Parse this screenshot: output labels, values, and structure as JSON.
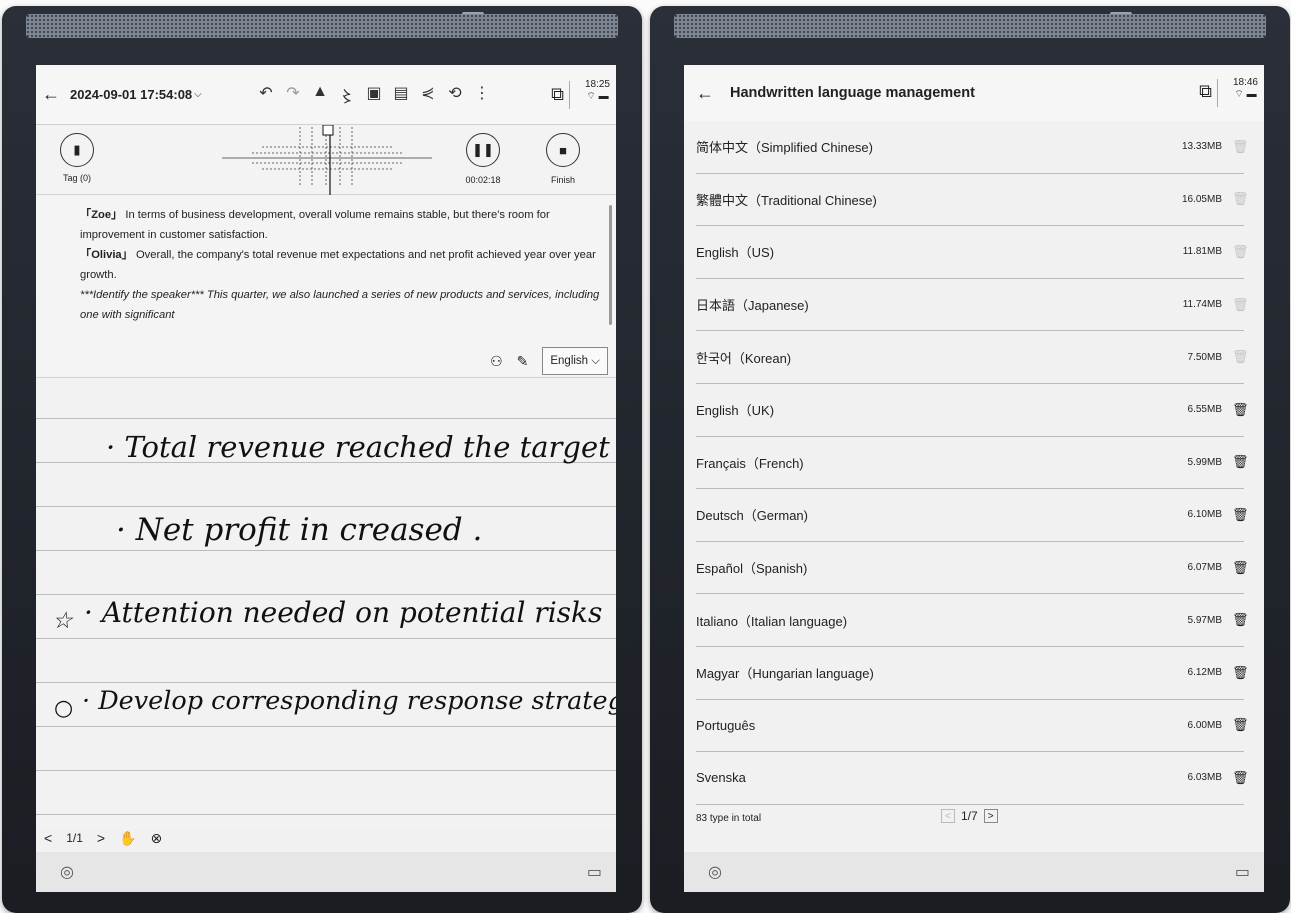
{
  "left": {
    "header": {
      "title": "2024-09-01 17:54:08",
      "caret": "⌵",
      "back_icon": "arrow-left-icon",
      "time": "18:25",
      "tools": [
        "⮌",
        "⮎",
        "▲",
        "〽",
        "◫",
        "▣",
        "⋘",
        "⟲",
        "⋮"
      ]
    },
    "recorder": {
      "tag_label": "Tag (0)",
      "pause_time": "00:02:18",
      "finish_label": "Finish"
    },
    "transcript": {
      "para1_speaker": "「Zoe」",
      "para1_text": " In terms of business development, overall volume remains stable, but there's room for improvement in customer satisfaction.",
      "para2_speaker": "「Olivia」",
      "para2_text": " Overall, the company's total revenue met expectations and net profit achieved year over year growth.",
      "para3_prefix": "***Identify the speaker***",
      "para3_text": " This quarter, we also launched a series of new products and services, including one with significant",
      "language": "English"
    },
    "notes": {
      "line1": "· Total revenue reached the target",
      "line2": "· Net profit in creased .",
      "line3_mark": "☆",
      "line3": "· Attention needed on potential risks",
      "line4_mark": "○",
      "line4": "· Develop corresponding response strategies"
    },
    "pagebar": {
      "prev": "<",
      "page": "1/1",
      "next": ">"
    }
  },
  "right": {
    "header": {
      "title": "Handwritten language management",
      "time": "18:46"
    },
    "languages": [
      {
        "name": "简体中文（Simplified Chinese)",
        "size": "13.33MB",
        "deletable": false
      },
      {
        "name": "繁體中文（Traditional Chinese)",
        "size": "16.05MB",
        "deletable": false
      },
      {
        "name": "English（US)",
        "size": "11.81MB",
        "deletable": false
      },
      {
        "name": "日本語（Japanese)",
        "size": "11.74MB",
        "deletable": false
      },
      {
        "name": "한국어（Korean)",
        "size": "7.50MB",
        "deletable": false
      },
      {
        "name": "English（UK)",
        "size": "6.55MB",
        "deletable": true
      },
      {
        "name": "Français（French)",
        "size": "5.99MB",
        "deletable": true
      },
      {
        "name": "Deutsch（German)",
        "size": "6.10MB",
        "deletable": true
      },
      {
        "name": "Español（Spanish)",
        "size": "6.07MB",
        "deletable": true
      },
      {
        "name": "Italiano（Italian language)",
        "size": "5.97MB",
        "deletable": true
      },
      {
        "name": "Magyar（Hungarian language)",
        "size": "6.12MB",
        "deletable": true
      },
      {
        "name": "Português",
        "size": "6.00MB",
        "deletable": true
      },
      {
        "name": "Svenska",
        "size": "6.03MB",
        "deletable": true
      }
    ],
    "footer": {
      "total": "83 type in total",
      "page": "1/7"
    }
  }
}
